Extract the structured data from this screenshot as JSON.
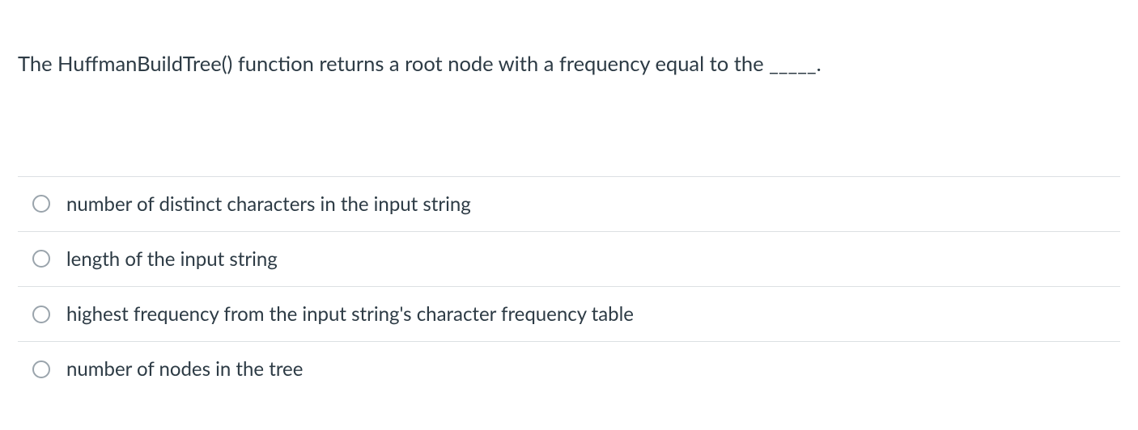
{
  "question": {
    "text": "The HuffmanBuildTree() function returns a root node with a frequency equal to the _____."
  },
  "options": [
    {
      "label": "number of distinct characters in the input string"
    },
    {
      "label": "length of the input string"
    },
    {
      "label": "highest frequency from the input string's character frequency table"
    },
    {
      "label": "number of nodes in the tree"
    }
  ]
}
